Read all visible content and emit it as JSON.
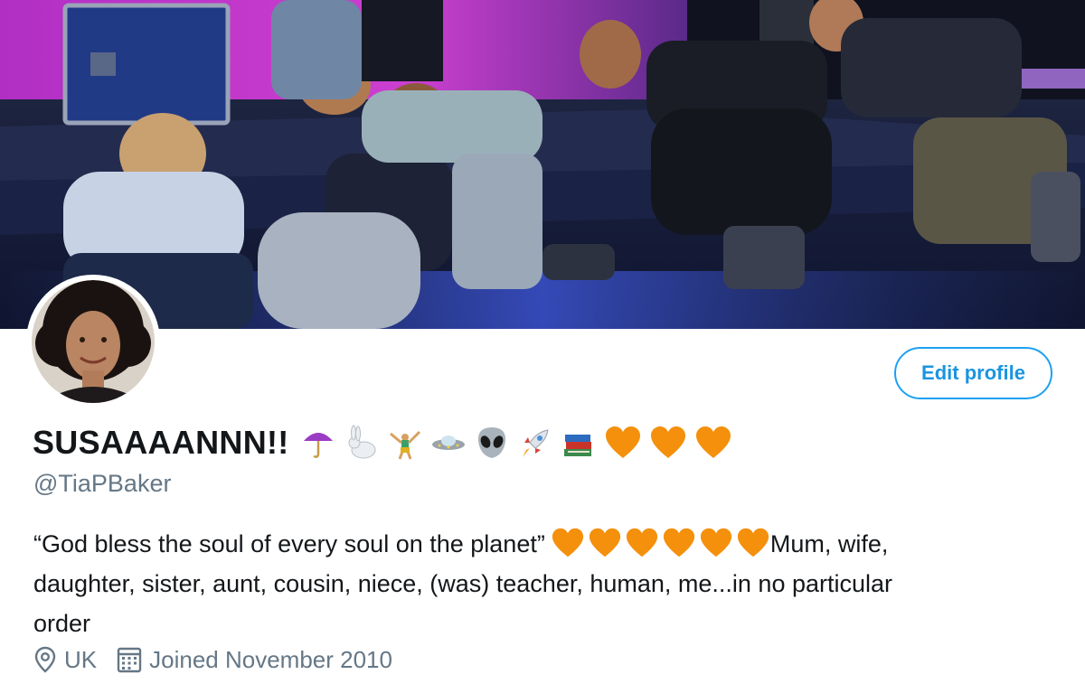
{
  "profile": {
    "display_name": "SUSAAAANNN!!",
    "name_emojis": [
      "umbrella-emoji",
      "rabbit-emoji",
      "cartwheel-emoji",
      "ufo-emoji",
      "alien-emoji",
      "rocket-emoji",
      "books-emoji",
      "orange-heart-emoji",
      "orange-heart-emoji",
      "orange-heart-emoji"
    ],
    "handle": "@TiaPBaker",
    "bio": {
      "quote": "“God bless the soul of every soul on the planet”",
      "hearts": [
        "orange-heart-emoji",
        "orange-heart-emoji",
        "orange-heart-emoji",
        "orange-heart-emoji",
        "orange-heart-emoji",
        "orange-heart-emoji"
      ],
      "rest_line1": "Mum, wife,",
      "line2": "daughter, sister, aunt, cousin, niece, (was) teacher, human, me...in no particular",
      "line3": "order"
    },
    "location": "UK",
    "joined": "Joined November 2010"
  },
  "actions": {
    "edit_profile_label": "Edit profile"
  },
  "icons": {
    "location": "location-pin-icon",
    "calendar": "calendar-icon"
  },
  "colors": {
    "accent": "#1da1f2",
    "name": "#14171a",
    "secondary": "#657786",
    "heart": "#f4900c"
  }
}
